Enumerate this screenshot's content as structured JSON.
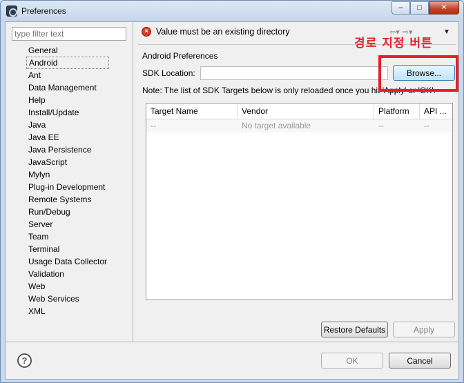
{
  "window": {
    "title": "Preferences",
    "controls": {
      "minimize": "–",
      "maximize": "□",
      "close": "✕"
    }
  },
  "filter": {
    "placeholder": "type filter text",
    "value": ""
  },
  "tree": {
    "selected": "Android",
    "items": [
      "General",
      "Android",
      "Ant",
      "Data Management",
      "Help",
      "Install/Update",
      "Java",
      "Java EE",
      "Java Persistence",
      "JavaScript",
      "Mylyn",
      "Plug-in Development",
      "Remote Systems",
      "Run/Debug",
      "Server",
      "Team",
      "Terminal",
      "Usage Data Collector",
      "Validation",
      "Web",
      "Web Services",
      "XML"
    ]
  },
  "message": {
    "icon": "error-icon",
    "text": "Value must be an existing directory"
  },
  "page": {
    "section_title": "Android Preferences",
    "sdk_label": "SDK Location:",
    "sdk_value": "",
    "browse_label": "Browse...",
    "note": "Note: The list of SDK Targets below is only reloaded once you hit 'Apply' or 'OK'."
  },
  "table": {
    "columns": [
      "Target Name",
      "Vendor",
      "Platform",
      "API ..."
    ],
    "rows": [
      [
        "--",
        "No target available",
        "--",
        "--"
      ]
    ]
  },
  "buttons": {
    "restore_defaults": "Restore Defaults",
    "apply": "Apply",
    "ok": "OK",
    "cancel": "Cancel",
    "help": "?"
  },
  "annotation": {
    "text": "경로 지정 버튼",
    "color": "#e5202a"
  },
  "colors": {
    "error": "#d33b2a",
    "accent_button": "#bde4f9"
  }
}
